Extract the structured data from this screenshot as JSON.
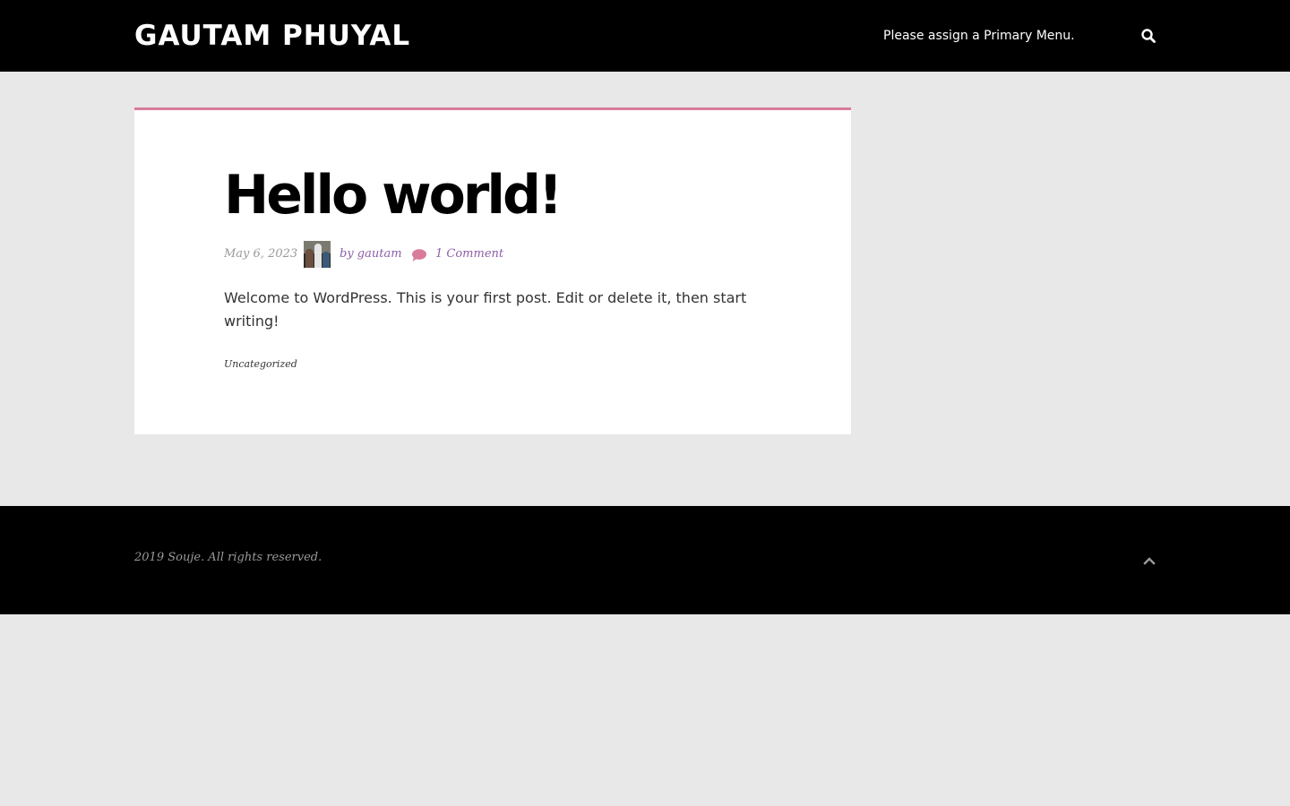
{
  "header": {
    "site_title": "GAUTAM PHUYAL",
    "menu_notice": "Please assign a Primary Menu.",
    "search_icon": "search-icon"
  },
  "post": {
    "title": "Hello world!",
    "date": "May 6, 2023",
    "author": "by gautam",
    "comments": "1 Comment",
    "excerpt": "Welcome to WordPress. This is your first post. Edit or delete it, then start writing!",
    "category": "Uncategorized",
    "accent_color": "#d97b9c",
    "link_color": "#8e5fa8"
  },
  "footer": {
    "copyright": "2019 Souje. All rights reserved.",
    "back_to_top_icon": "chevron-up-icon"
  }
}
